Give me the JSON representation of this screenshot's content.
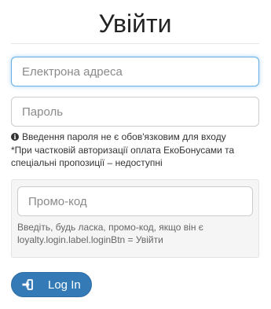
{
  "header": {
    "title": "Увійти"
  },
  "form": {
    "email_placeholder": "Електрона адреса",
    "password_placeholder": "Пароль",
    "password_note": "Введення пароля не є обов'язковим для входу",
    "partial_auth_note": "*При частковій авторизації оплата ЕкоБонусами та спеціальні пропозиції – недоступні"
  },
  "promo": {
    "placeholder": "Промо-код",
    "help": "Введіть, будь ласка, промо-код, якщо він є loyalty.login.label.loginBtn = Увійти"
  },
  "login_button": {
    "label": "Log In",
    "icon": "sign-in-icon"
  },
  "colors": {
    "accent": "#337ab7",
    "focus_border": "#66afe9",
    "promo_background": "#f5f5f5"
  }
}
